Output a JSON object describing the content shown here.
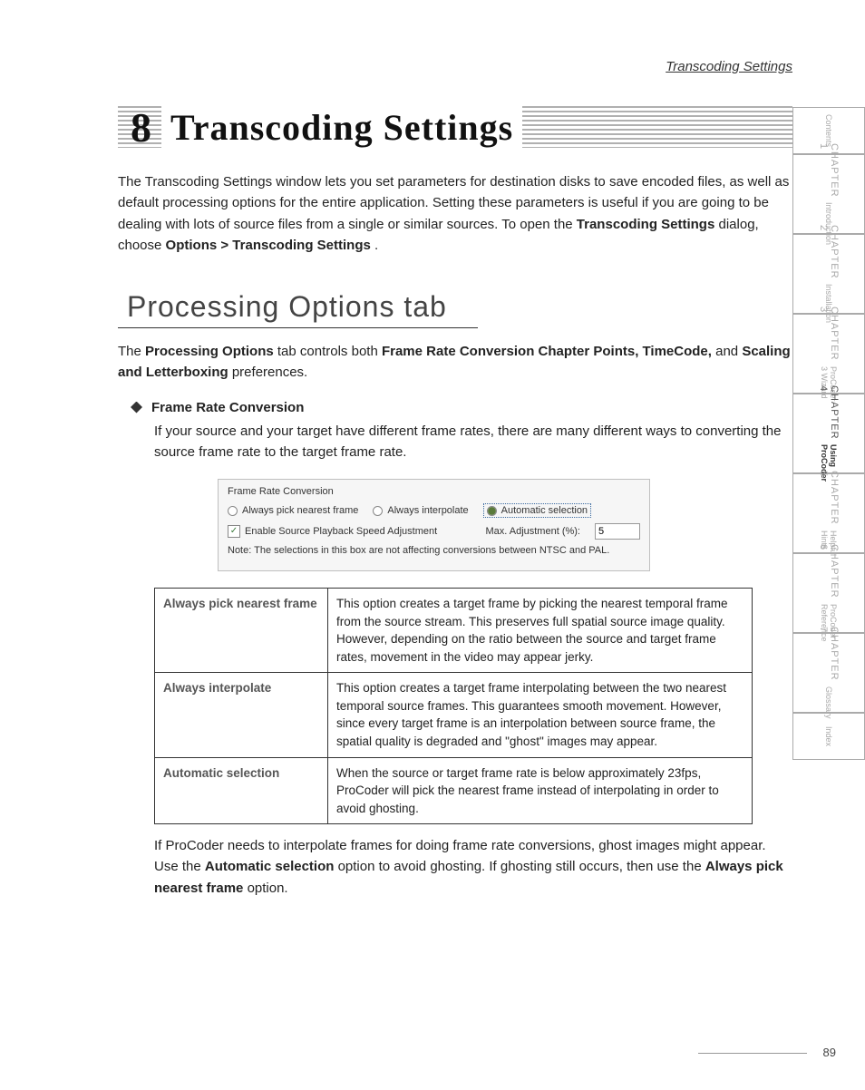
{
  "running_head": "Transcoding Settings",
  "title": {
    "num": "8",
    "line": "Transcoding Settings"
  },
  "intro": {
    "p1_a": "The Transcoding Settings window lets you set parameters for destination disks to save encoded files, as well as default processing options for the entire application. Setting these parameters is useful if you are going to be dealing with lots of source files from a single or similar sources. To open the ",
    "p1_b": "Transcoding Settings",
    "p1_c": " dialog, choose ",
    "p1_d": "Options > Transcoding Settings",
    "p1_e": "."
  },
  "h2": "Processing Options tab",
  "subintro": {
    "a": "The ",
    "b": "Processing Options",
    "c": " tab controls both ",
    "d": "Frame Rate Conversion Chapter Points, TimeCode,",
    "e": " and ",
    "f": "Scaling and Letterboxing",
    "g": " preferences."
  },
  "bullet": "Frame Rate Conversion",
  "bullet_body": "If your source and your target have different frame rates, there are many different ways to converting the source frame rate to the target frame rate.",
  "shot": {
    "group": "Frame Rate Conversion",
    "r1": "Always pick nearest frame",
    "r2": "Always interpolate",
    "r3": "Automatic selection",
    "c1": "Enable Source Playback Speed Adjustment",
    "max": "Max. Adjustment (%):",
    "maxval": "5",
    "note": "Note: The selections in this box are not affecting conversions between NTSC and PAL."
  },
  "table": {
    "r1k": "Always pick nearest frame",
    "r1v": "This option creates a target frame by picking the nearest temporal frame from the source stream. This preserves full spatial source image quality. However, depending on the ratio between the source and target frame rates, movement in the video may appear jerky.",
    "r2k": "Always interpolate",
    "r2v": "This option creates a target frame interpolating between the two nearest temporal source frames. This guarantees smooth movement. However, since every target frame is an interpolation between source frame, the spatial quality is degraded and \"ghost\" images may appear.",
    "r3k": "Automatic selection",
    "r3v": "When the source or target frame rate is below approximately 23fps, ProCoder will pick the nearest frame instead of interpolating in order to avoid ghosting."
  },
  "closing": {
    "a": "If ProCoder needs to interpolate frames for doing frame rate conversions, ghost images might appear. Use the ",
    "b": "Automatic selection",
    "c": " option to avoid ghosting. If ghosting still occurs, then use the ",
    "d": "Always pick nearest frame",
    "e": " option."
  },
  "side": [
    {
      "big": "",
      "sub": "Contents",
      "small": true
    },
    {
      "big": "CHAPTER 1",
      "sub": "Introduction"
    },
    {
      "big": "CHAPTER 2",
      "sub": "Installation"
    },
    {
      "big": "CHAPTER 3",
      "sub": "ProCoder 3 Wizard"
    },
    {
      "big": "CHAPTER 4",
      "sub": "Using ProCoder",
      "active": true
    },
    {
      "big": "CHAPTER 5",
      "sub": "Helpful Hints"
    },
    {
      "big": "CHAPTER 6",
      "sub": "ProCoder Reference"
    },
    {
      "big": "CHAPTER 7",
      "sub": "Glossary"
    },
    {
      "big": "",
      "sub": "Index",
      "small": true
    }
  ],
  "page": "89"
}
